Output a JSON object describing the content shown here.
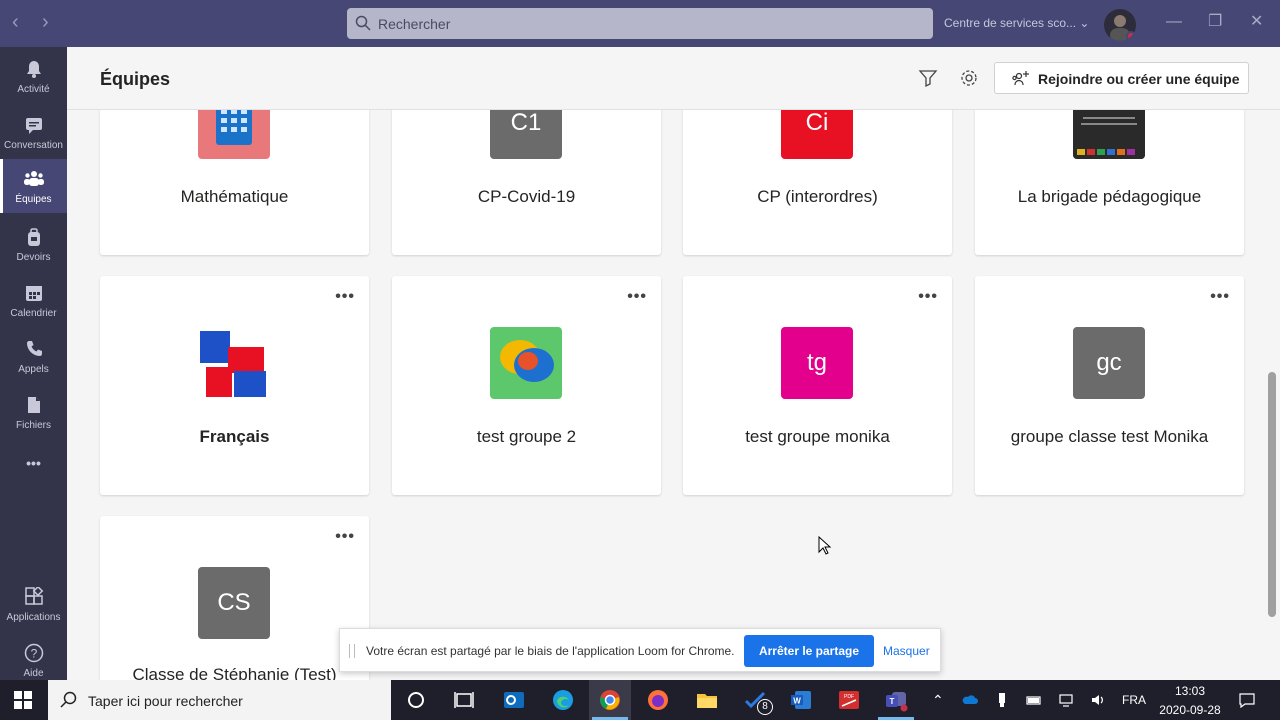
{
  "titlebar": {
    "search_placeholder": "Rechercher",
    "org": "Centre de services sco...",
    "back_icon": "chevron-left-icon",
    "forward_icon": "chevron-right-icon"
  },
  "sidebar": {
    "items": [
      {
        "label": "Activité",
        "icon": "bell-icon"
      },
      {
        "label": "Conversation",
        "icon": "chat-icon"
      },
      {
        "label": "Équipes",
        "icon": "teams-icon",
        "active": true
      },
      {
        "label": "Devoirs",
        "icon": "backpack-icon"
      },
      {
        "label": "Calendrier",
        "icon": "calendar-icon"
      },
      {
        "label": "Appels",
        "icon": "phone-icon"
      },
      {
        "label": "Fichiers",
        "icon": "file-icon"
      }
    ],
    "more": "•••",
    "bottom_items": [
      {
        "label": "Applications",
        "icon": "apps-icon"
      },
      {
        "label": "Aide",
        "icon": "help-icon"
      }
    ]
  },
  "header": {
    "title": "Équipes",
    "join_button": "Rejoindre ou créer une équipe"
  },
  "teams": [
    {
      "name": "Mathématique",
      "tile": "calculator",
      "color": "#e8787a"
    },
    {
      "name": "CP-Covid-19",
      "initials": "C1",
      "color": "#6b6b6b"
    },
    {
      "name": "CP (interordres)",
      "initials": "Ci",
      "color": "#e81123"
    },
    {
      "name": "La brigade pédagogique",
      "tile": "book",
      "color": "#2a2a2a"
    },
    {
      "name": "Français",
      "tile": "francais",
      "color": "#ffffff",
      "bold": true
    },
    {
      "name": "test groupe 2",
      "tile": "chat-bubbles",
      "color": "#5dc86b"
    },
    {
      "name": "test groupe monika",
      "initials": "tg",
      "color": "#e3008c"
    },
    {
      "name": "groupe classe test Monika",
      "initials": "gc",
      "color": "#6b6b6b"
    },
    {
      "name": "Classe de Stéphanie (Test)",
      "initials": "CS",
      "color": "#6b6b6b"
    }
  ],
  "more_label": "•••",
  "sharebar": {
    "message": "Votre écran est partagé par le biais de l'application Loom for Chrome.",
    "stop": "Arrêter le partage",
    "hide": "Masquer"
  },
  "taskbar": {
    "search_placeholder": "Taper ici pour rechercher",
    "badge": "8",
    "lang": "FRA",
    "time": "13:03",
    "date": "2020-09-28"
  }
}
